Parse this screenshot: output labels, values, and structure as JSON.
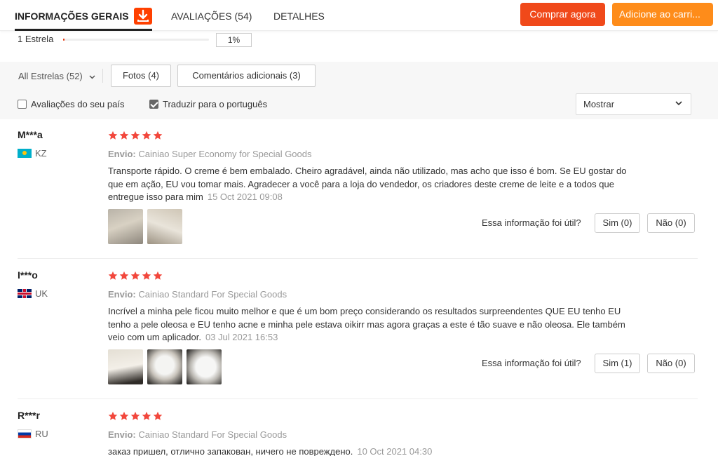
{
  "tabs": [
    {
      "label": "INFORMAÇÕES GERAIS",
      "active": true
    },
    {
      "label": "AVALIAÇÕES (54)",
      "active": false
    },
    {
      "label": "DETALHES",
      "active": false
    }
  ],
  "actions": {
    "buy_now": "Comprar agora",
    "add_to_cart": "Adicione ao carri..."
  },
  "star_breakdown": {
    "label": "1 Estrela",
    "percent_text": "1%",
    "fill_fraction": 0.01
  },
  "filters": {
    "all_stars": "All Estrelas (52)",
    "photos": "Fotos (4)",
    "additional_comments": "Comentários adicionais (3)",
    "own_country": {
      "label": "Avaliações do seu país",
      "checked": false
    },
    "translate": {
      "label": "Traduzir para o português",
      "checked": true
    },
    "show": "Mostrar"
  },
  "reviews": [
    {
      "user": "M***a",
      "country": "KZ",
      "stars": 5,
      "shipping_label": "Envio:",
      "shipping": "Cainiao Super Economy for Special Goods",
      "text": "Transporte rápido. O creme é bem embalado. Cheiro agradável, ainda não utilizado, mas acho que isso é bom. Se EU gostar do que em ação, EU vou tomar mais. Agradecer a você para a loja do vendedor, os criadores deste creme de leite e a todos que entregue isso para mim",
      "date": "15 Oct 2021 09:08",
      "photos": 2,
      "helpful_q": "Essa informação foi útil?",
      "yes": "Sim (0)",
      "no": "Não (0)"
    },
    {
      "user": "I***o",
      "country": "UK",
      "stars": 5,
      "shipping_label": "Envio:",
      "shipping": "Cainiao Standard For Special Goods",
      "text": "Incrível a minha pele ficou muito melhor e que é um bom preço considerando os resultados surpreendentes QUE EU tenho EU tenho a pele oleosa e EU tenho acne e minha pele estava oikirr mas agora graças a este é tão suave e não oleosa. Ele também veio com um aplicador.",
      "date": "03 Jul 2021 16:53",
      "photos": 3,
      "helpful_q": "Essa informação foi útil?",
      "yes": "Sim (1)",
      "no": "Não (0)"
    },
    {
      "user": "R***r",
      "country": "RU",
      "stars": 5,
      "shipping_label": "Envio:",
      "shipping": "Cainiao Standard For Special Goods",
      "text": "заказ пришел, отлично запакован, ничего не повреждено.",
      "date": "10 Oct 2021 04:30"
    }
  ],
  "colors": {
    "accent_red": "#f0491a",
    "accent_orange": "#fe8c1a",
    "star": "#f2473c"
  },
  "icons": [
    "download-badge-icon",
    "chevron-down-icon",
    "star-icon",
    "flag-icon"
  ]
}
